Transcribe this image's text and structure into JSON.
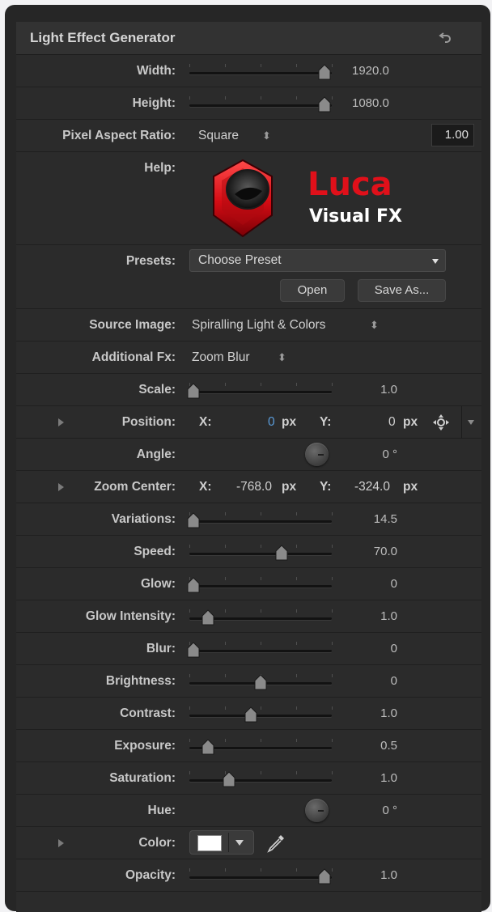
{
  "panel": {
    "title": "Light Effect Generator",
    "reset_icon": "reset-arrow-icon"
  },
  "width": {
    "label": "Width:",
    "value": "1920.0",
    "fraction": 0.95
  },
  "height": {
    "label": "Height:",
    "value": "1080.0",
    "fraction": 0.95
  },
  "pixel_aspect": {
    "label": "Pixel Aspect Ratio:",
    "selected": "Square",
    "ratio": "1.00"
  },
  "help": {
    "label": "Help:",
    "logo_text_top": "Luca",
    "logo_text_bottom": "Visual FX",
    "logo_color": "#e0101a"
  },
  "presets": {
    "label": "Presets:",
    "selected": "Choose Preset",
    "open_label": "Open",
    "save_as_label": "Save As..."
  },
  "source_image": {
    "label": "Source Image:",
    "selected": "Spiralling Light & Colors"
  },
  "additional_fx": {
    "label": "Additional Fx:",
    "selected": "Zoom Blur"
  },
  "scale": {
    "label": "Scale:",
    "value": "1.0",
    "fraction": 0.03
  },
  "position": {
    "label": "Position:",
    "x_label": "X:",
    "x_value": "0",
    "y_label": "Y:",
    "y_value": "0",
    "unit": "px"
  },
  "angle": {
    "label": "Angle:",
    "value": "0 °"
  },
  "zoom_center": {
    "label": "Zoom Center:",
    "x_label": "X:",
    "x_value": "-768.0",
    "y_label": "Y:",
    "y_value": "-324.0",
    "unit": "px"
  },
  "sliders": [
    {
      "key": "variations",
      "label": "Variations:",
      "value": "14.5",
      "fraction": 0.03
    },
    {
      "key": "speed",
      "label": "Speed:",
      "value": "70.0",
      "fraction": 0.65
    },
    {
      "key": "glow",
      "label": "Glow:",
      "value": "0",
      "fraction": 0.03
    },
    {
      "key": "glow-intensity",
      "label": "Glow Intensity:",
      "value": "1.0",
      "fraction": 0.13
    },
    {
      "key": "blur",
      "label": "Blur:",
      "value": "0",
      "fraction": 0.03
    },
    {
      "key": "brightness",
      "label": "Brightness:",
      "value": "0",
      "fraction": 0.5
    },
    {
      "key": "contrast",
      "label": "Contrast:",
      "value": "1.0",
      "fraction": 0.43
    },
    {
      "key": "exposure",
      "label": "Exposure:",
      "value": "0.5",
      "fraction": 0.13
    },
    {
      "key": "saturation",
      "label": "Saturation:",
      "value": "1.0",
      "fraction": 0.28
    }
  ],
  "hue": {
    "label": "Hue:",
    "value": "0 °"
  },
  "color": {
    "label": "Color:",
    "swatch": "#ffffff",
    "eyedropper_icon": "eyedropper-icon"
  },
  "opacity": {
    "label": "Opacity:",
    "value": "1.0",
    "fraction": 0.95
  },
  "colors": {
    "panel_bg": "#2b2b2b",
    "text": "#c8c8c8",
    "accent_blue": "#5a9bd8"
  }
}
